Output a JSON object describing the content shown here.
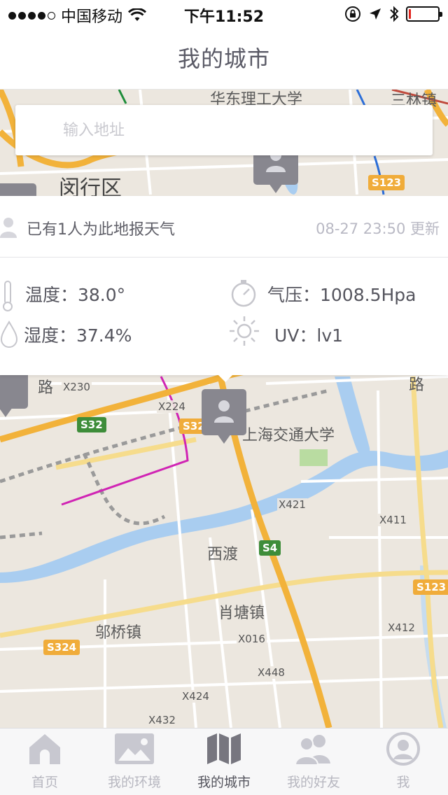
{
  "status_bar": {
    "carrier": "中国移动",
    "time": "下午11:52",
    "battery_level": 0.08,
    "icons": [
      "signal-dots",
      "wifi-icon",
      "lock-rotation-icon",
      "location-arrow-icon",
      "bluetooth-icon",
      "battery-icon"
    ]
  },
  "nav": {
    "title": "我的城市"
  },
  "search": {
    "placeholder": "输入地址"
  },
  "info": {
    "report_text": "已有1人为此地报天气",
    "update_time": "08-27 23:50 更新",
    "temperature": "温度：38.0°",
    "pressure": "气压：1008.5Hpa",
    "humidity": "湿度：37.4%",
    "uv": "UV：lv1"
  },
  "map": {
    "labels": {
      "university_top": "华东理工大学",
      "sanlin": "三林镇",
      "minhang": "闵行区",
      "sjtu": "上海交通大学",
      "xidu": "西渡",
      "xiaotang": "肖塘镇",
      "zhuqiao": "邬桥镇",
      "lu_left": "路",
      "lu_right": "路"
    },
    "shields": {
      "s123_top": "S123",
      "s32": "S32",
      "s32b": "S32",
      "s4": "S4",
      "s123_right": "S123",
      "s324": "S324"
    },
    "roads": {
      "x230": "X230",
      "x224": "X224",
      "x421": "X421",
      "x411": "X411",
      "x412": "X412",
      "x016": "X016",
      "x448": "X448",
      "x424": "X424",
      "x432": "X432"
    },
    "colors": {
      "land": "#ece7df",
      "water": "#a9cdf0",
      "highway": "#f4b73d",
      "road": "#ffffff",
      "metro": "#d024b4"
    }
  },
  "tabs": [
    {
      "label": "首页",
      "icon": "home-icon",
      "active": false
    },
    {
      "label": "我的环境",
      "icon": "image-icon",
      "active": false
    },
    {
      "label": "我的城市",
      "icon": "map-icon",
      "active": true
    },
    {
      "label": "我的好友",
      "icon": "friends-icon",
      "active": false
    },
    {
      "label": "我",
      "icon": "user-circle-icon",
      "active": false
    }
  ]
}
